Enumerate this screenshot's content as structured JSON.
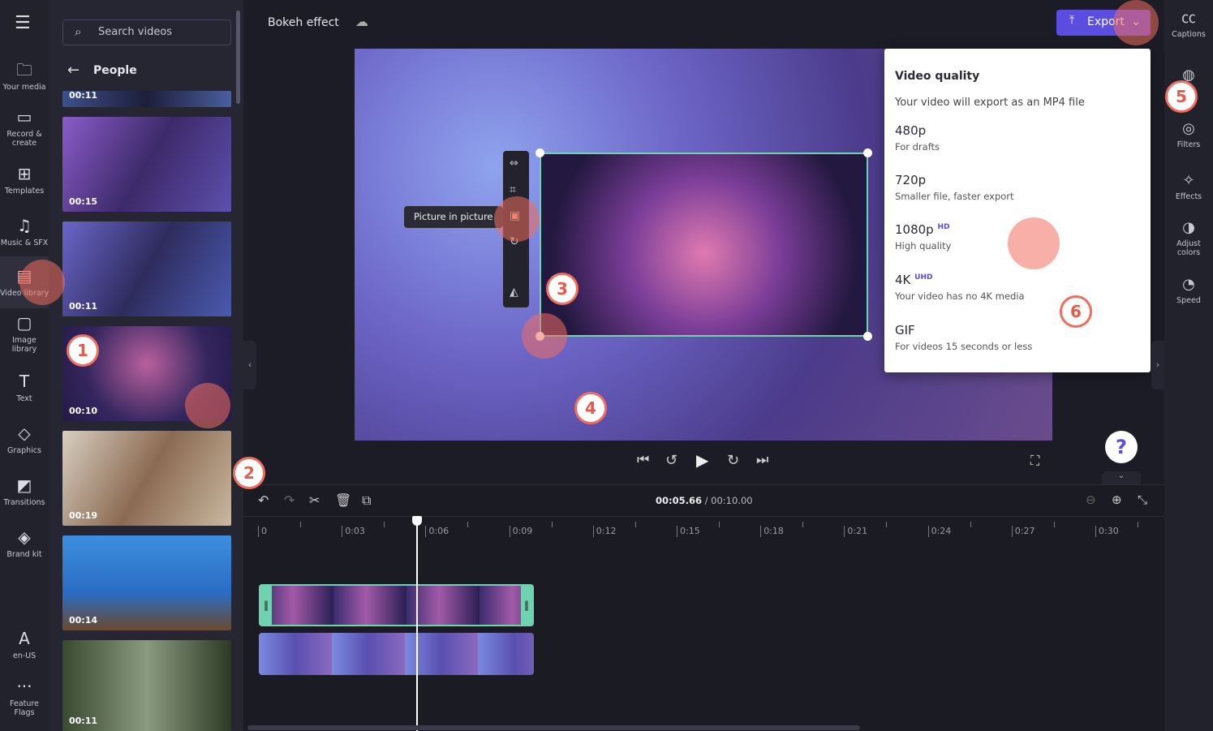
{
  "nav": {
    "items": [
      {
        "label": "Your media",
        "icon": "folder-icon"
      },
      {
        "label": "Record & create",
        "icon": "camera-icon"
      },
      {
        "label": "Templates",
        "icon": "templates-icon"
      },
      {
        "label": "Music & SFX",
        "icon": "music-icon"
      },
      {
        "label": "Video library",
        "icon": "film-icon"
      },
      {
        "label": "Image library",
        "icon": "image-icon"
      },
      {
        "label": "Text",
        "icon": "text-icon"
      },
      {
        "label": "Graphics",
        "icon": "shapes-icon"
      },
      {
        "label": "Transitions",
        "icon": "transitions-icon"
      },
      {
        "label": "Brand kit",
        "icon": "brand-icon"
      },
      {
        "label": "en-US",
        "icon": "language-icon"
      },
      {
        "label": "Feature Flags",
        "icon": "more-icon"
      }
    ]
  },
  "panel": {
    "search_placeholder": "Search videos",
    "category": "People",
    "videos": [
      {
        "duration": "00:11"
      },
      {
        "duration": "00:15"
      },
      {
        "duration": "00:11"
      },
      {
        "duration": "00:10"
      },
      {
        "duration": "00:19"
      },
      {
        "duration": "00:14"
      },
      {
        "duration": "00:11"
      }
    ]
  },
  "header": {
    "project_title": "Bokeh effect",
    "export_label": "Export",
    "accent": "#5b4de0"
  },
  "tooltip": "Picture in picture",
  "export_menu": {
    "title": "Video quality",
    "subtitle": "Your video will export as an MP4 file",
    "options": [
      {
        "label": "480p",
        "badge": "",
        "desc": "For drafts"
      },
      {
        "label": "720p",
        "badge": "",
        "desc": "Smaller file, faster export"
      },
      {
        "label": "1080p",
        "badge": "HD",
        "desc": "High quality"
      },
      {
        "label": "4K",
        "badge": "UHD",
        "desc": "Your video has no 4K media"
      },
      {
        "label": "GIF",
        "badge": "",
        "desc": "For videos 15 seconds or less"
      }
    ]
  },
  "right_sidebar": {
    "items": [
      {
        "label": "Captions",
        "icon": "cc-icon"
      },
      {
        "label": "Fade",
        "icon": "fade-icon"
      },
      {
        "label": "Filters",
        "icon": "filters-icon"
      },
      {
        "label": "Effects",
        "icon": "wand-icon"
      },
      {
        "label": "Adjust colors",
        "icon": "contrast-icon"
      },
      {
        "label": "Speed",
        "icon": "speed-icon"
      }
    ]
  },
  "timeline": {
    "current_time": "00:05.66",
    "total_time": "/ 00:10.00",
    "ruler": [
      "0",
      "0:03",
      "0:06",
      "0:09",
      "0:12",
      "0:15",
      "0:18",
      "0:21",
      "0:24",
      "0:27",
      "0:30"
    ],
    "playhead_seconds": 5.66
  },
  "help_label": "?",
  "steps": [
    "1",
    "2",
    "3",
    "4",
    "5",
    "6"
  ]
}
